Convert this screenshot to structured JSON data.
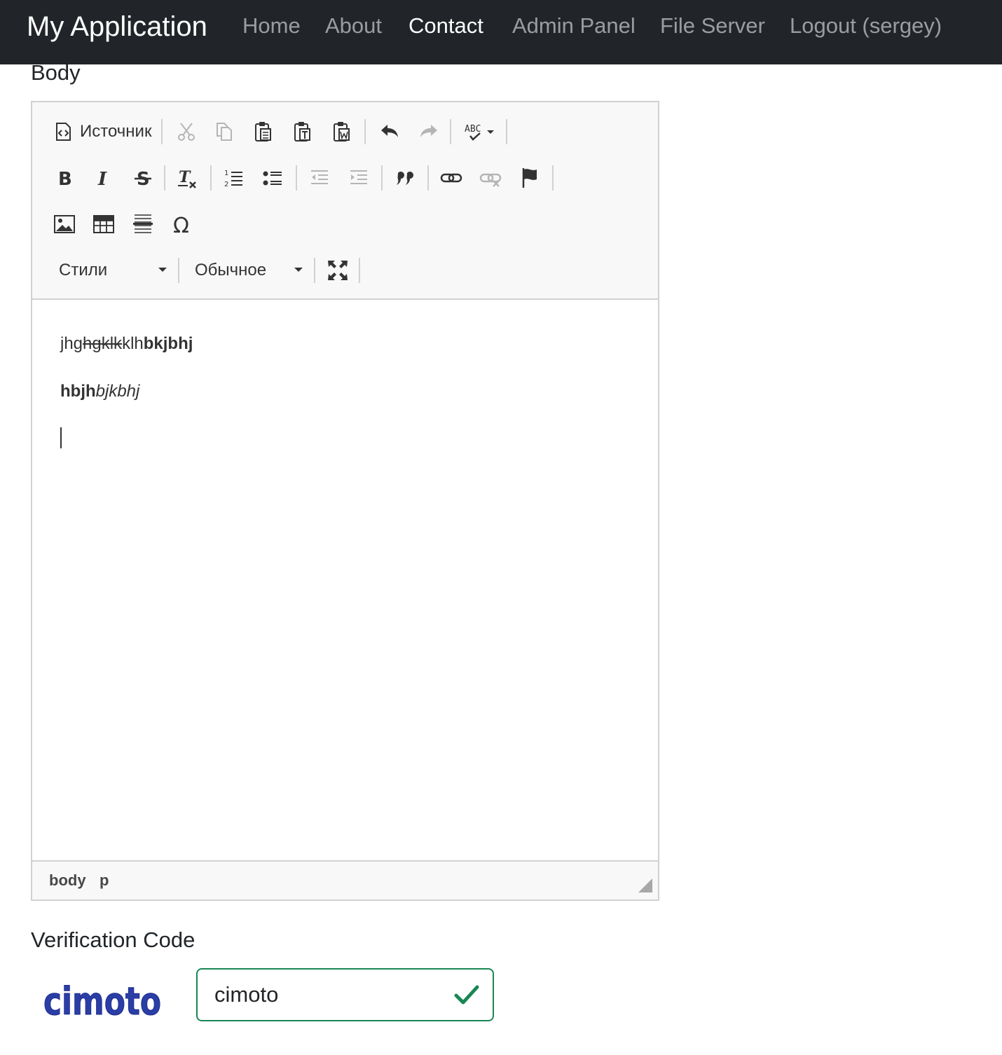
{
  "navbar": {
    "brand": "My Application",
    "links": [
      {
        "label": "Home",
        "active": false
      },
      {
        "label": "About",
        "active": false
      },
      {
        "label": "Contact",
        "active": true
      },
      {
        "label": "Admin Panel",
        "active": false
      },
      {
        "label": "File Server",
        "active": false
      },
      {
        "label": "Logout (sergey)",
        "active": false
      }
    ]
  },
  "form": {
    "body_label": "Body",
    "verification_label": "Verification Code",
    "captcha_text": "cimoto",
    "captcha_input_value": "cimoto"
  },
  "editor": {
    "source_label": "Источник",
    "styles_combo": "Стили",
    "format_combo": "Обычное",
    "toolbar_icons": [
      "cut-icon",
      "copy-icon",
      "paste-icon",
      "paste-text-icon",
      "paste-word-icon",
      "undo-icon",
      "redo-icon",
      "spellcheck-icon",
      "bold-icon",
      "italic-icon",
      "strike-icon",
      "remove-format-icon",
      "numbered-list-icon",
      "bulleted-list-icon",
      "outdent-icon",
      "indent-icon",
      "blockquote-icon",
      "link-icon",
      "unlink-icon",
      "anchor-icon",
      "image-icon",
      "table-icon",
      "horizontal-line-icon",
      "special-char-icon",
      "maximize-icon"
    ],
    "content": {
      "p1_plain": "jhg",
      "p1_strike": "hgklk",
      "p1_plain2": "klh",
      "p1_bold": "bkjbhj",
      "p2_bold": "hbjh",
      "p2_italic": "bjkbhj"
    },
    "path": [
      "body",
      "p"
    ]
  },
  "colors": {
    "navbar_bg": "#212529",
    "valid_green": "#198754",
    "captcha_blue": "#2b3ea6"
  }
}
